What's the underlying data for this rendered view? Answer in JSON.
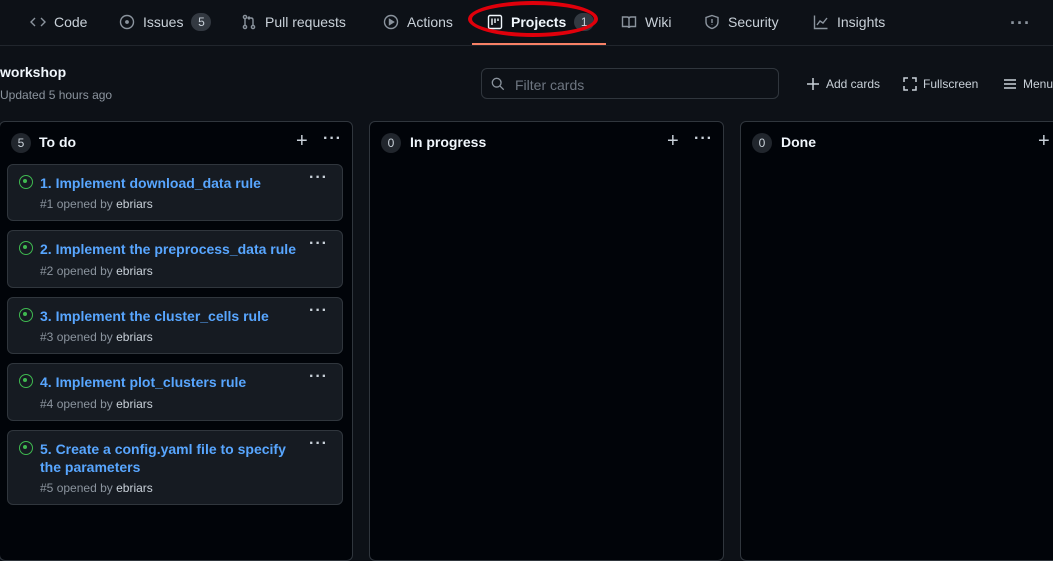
{
  "nav": {
    "items": [
      {
        "label": "Code",
        "icon": "code-icon"
      },
      {
        "label": "Issues",
        "icon": "issue-icon",
        "count": "5"
      },
      {
        "label": "Pull requests",
        "icon": "pull-request-icon"
      },
      {
        "label": "Actions",
        "icon": "play-icon"
      },
      {
        "label": "Projects",
        "icon": "project-icon",
        "count": "1",
        "active": true
      },
      {
        "label": "Wiki",
        "icon": "book-icon"
      },
      {
        "label": "Security",
        "icon": "shield-icon"
      },
      {
        "label": "Insights",
        "icon": "graph-icon"
      }
    ],
    "more": "···"
  },
  "project": {
    "title": "workshop",
    "updated": "Updated 5 hours ago",
    "filter_placeholder": "Filter cards",
    "add_cards": "Add cards",
    "fullscreen": "Fullscreen",
    "menu": "Menu"
  },
  "columns": [
    {
      "name": "To do",
      "count": "5",
      "cards": [
        {
          "title": "1. Implement download_data rule",
          "number": "#1",
          "opened_by": "opened by",
          "user": "ebriars"
        },
        {
          "title": "2. Implement the preprocess_data rule",
          "number": "#2",
          "opened_by": "opened by",
          "user": "ebriars"
        },
        {
          "title": "3. Implement the cluster_cells rule",
          "number": "#3",
          "opened_by": "opened by",
          "user": "ebriars"
        },
        {
          "title": "4. Implement plot_clusters rule",
          "number": "#4",
          "opened_by": "opened by",
          "user": "ebriars"
        },
        {
          "title": "5. Create a config.yaml file to specify the parameters",
          "number": "#5",
          "opened_by": "opened by",
          "user": "ebriars"
        }
      ]
    },
    {
      "name": "In progress",
      "count": "0",
      "cards": []
    },
    {
      "name": "Done",
      "count": "0",
      "cards": []
    }
  ],
  "colors": {
    "background": "#0d1117",
    "accent_underline": "#f78166",
    "link": "#58a6ff",
    "open_issue": "#3fb950",
    "annotation_circle": "#e0000b"
  }
}
